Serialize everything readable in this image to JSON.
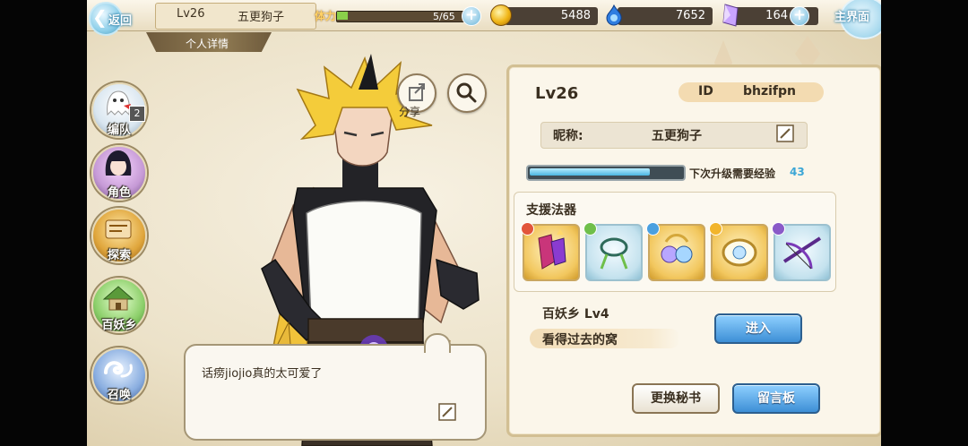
{
  "header": {
    "back_label": "返回",
    "player_level": "Lv26",
    "player_name": "五更狗子",
    "tab_label": "个人详情",
    "stamina_label": "体力",
    "stamina_text": "5/65",
    "stamina_fraction": 0.077,
    "gold": "5488",
    "gems": "7652",
    "crystals": "164",
    "home_label": "主界面"
  },
  "side_nav": {
    "items": [
      {
        "label": "编队",
        "badge": "2"
      },
      {
        "label": "角色"
      },
      {
        "label": "探索"
      },
      {
        "label": "百妖乡"
      },
      {
        "label": "召唤"
      }
    ]
  },
  "actions": {
    "share_label": "分享"
  },
  "speech": {
    "text": "话痨jiojio真的太可爱了"
  },
  "profile": {
    "level": "Lv26",
    "id_label": "ID",
    "id_value": "bhzifpn",
    "nickname_label": "昵称:",
    "nickname_value": "五更狗子",
    "exp_label": "下次升级需要经验",
    "exp_needed": "43",
    "exp_fraction": 0.79,
    "support_title": "支援法器",
    "support_items": [
      {
        "icon": "potion-bottles-icon",
        "rarity": "gold",
        "gem_color": "#e2553b"
      },
      {
        "icon": "jade-ring-icon",
        "rarity": "blue",
        "gem_color": "#6fbf4a"
      },
      {
        "icon": "pearl-bell-icon",
        "rarity": "gold",
        "gem_color": "#4aa0e0"
      },
      {
        "icon": "orb-brooch-icon",
        "rarity": "gold",
        "gem_color": "#f2b52c"
      },
      {
        "icon": "crossbow-icon",
        "rarity": "blue",
        "gem_color": "#8a5ac8"
      }
    ],
    "village_title": "百妖乡  Lv4",
    "village_desc": "看得过去的窝",
    "enter_label": "进入",
    "secretary_label": "更换秘书",
    "board_label": "留言板"
  }
}
